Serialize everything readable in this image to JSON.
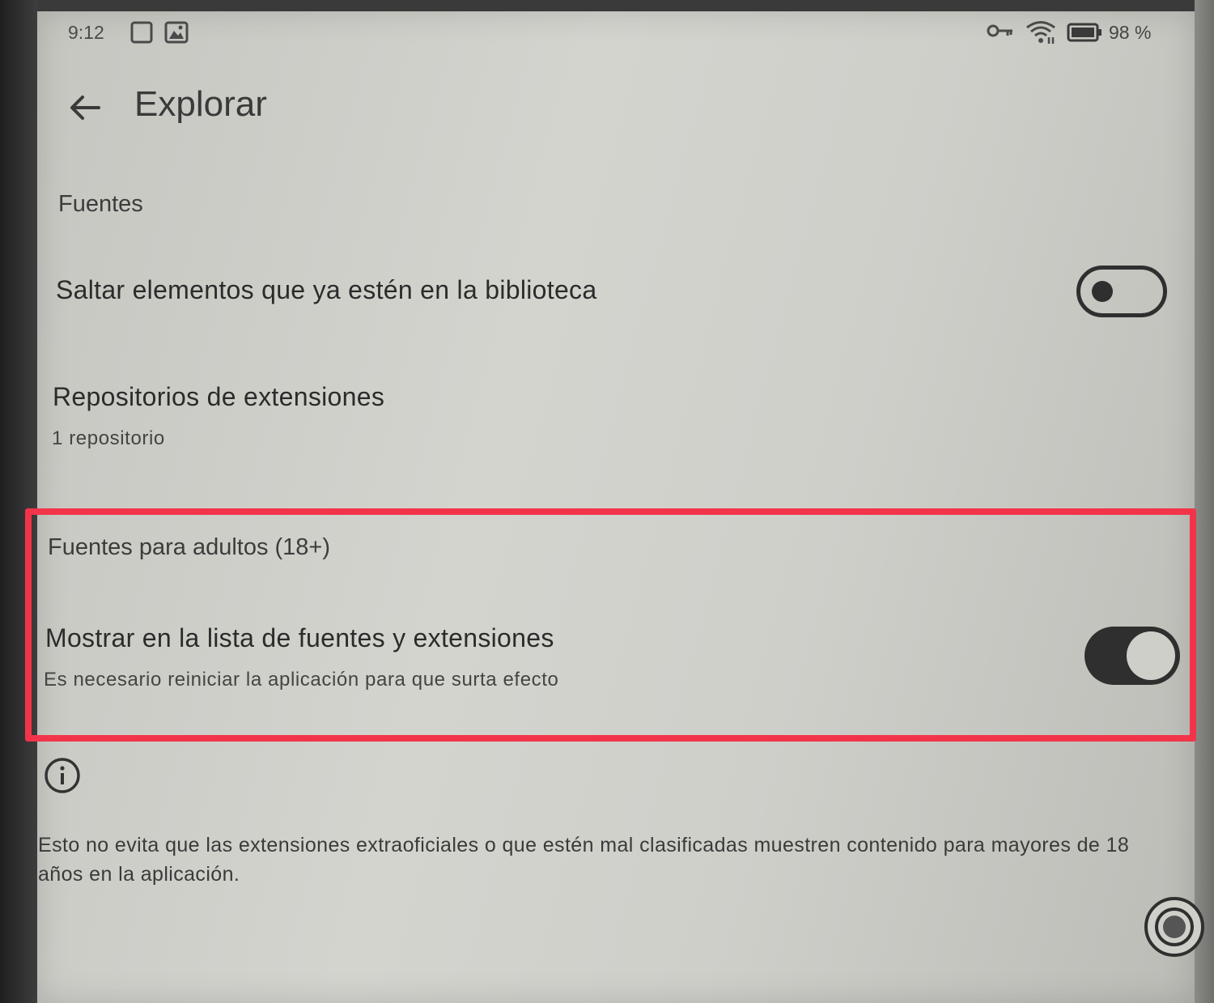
{
  "status_bar": {
    "time": "9:12",
    "battery_percent": "98 %",
    "icons": [
      "square-outline-icon",
      "image-icon",
      "key-icon",
      "wifi-icon",
      "battery-icon"
    ]
  },
  "app_bar": {
    "title": "Explorar",
    "back_icon": "back-arrow-icon"
  },
  "sections": {
    "sources_header": "Fuentes",
    "skip_library": {
      "title": "Saltar elementos que ya estén en la biblioteca",
      "enabled": false
    },
    "repos": {
      "title": "Repositorios de extensiones",
      "subtitle": "1 repositorio"
    },
    "adult_header": "Fuentes para adultos (18+)",
    "show_adult": {
      "title": "Mostrar en la lista de fuentes y extensiones",
      "subtitle": "Es necesario reiniciar la aplicación para que surta efecto",
      "enabled": true
    }
  },
  "info": {
    "icon": "info-icon",
    "text": "Esto no evita que las extensiones extraoficiales o que estén mal clasificadas muestren contenido para mayores de 18 años en la aplicación."
  },
  "colors": {
    "highlight_border": "#f2344a",
    "screen_bg": "#cfcfca",
    "text": "#2e2e2e"
  }
}
